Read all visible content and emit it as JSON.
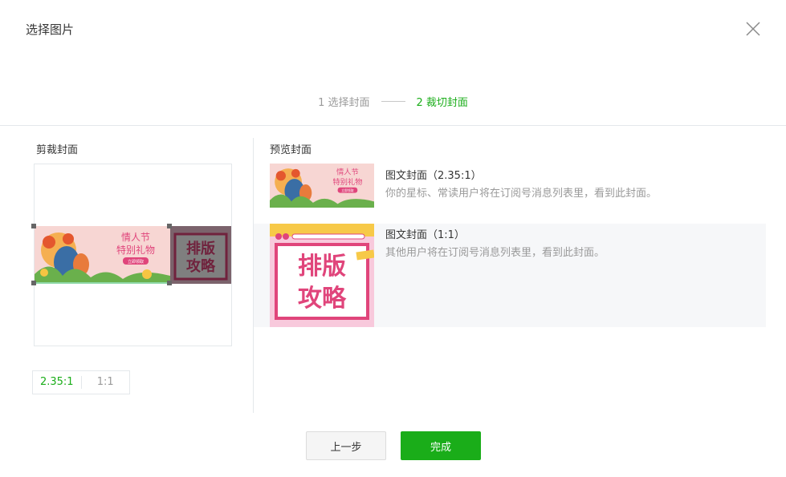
{
  "dialog": {
    "title": "选择图片"
  },
  "steps": [
    {
      "label": "1 选择封面",
      "active": false
    },
    {
      "label": "2 裁切封面",
      "active": true
    }
  ],
  "crop": {
    "label": "剪裁封面",
    "ratio_options": [
      {
        "label": "2.35:1",
        "active": true
      },
      {
        "label": "1:1",
        "active": false
      }
    ]
  },
  "preview": {
    "label": "预览封面",
    "items": [
      {
        "title": "图文封面（2.35:1）",
        "desc": "你的星标、常读用户将在订阅号消息列表里，看到此封面。"
      },
      {
        "title": "图文封面（1:1）",
        "desc": "其他用户将在订阅号消息列表里，看到此封面。"
      }
    ]
  },
  "cover_art": {
    "valentine_line1": "情人节",
    "valentine_line2": "特别礼物",
    "valentine_badge": "立即领取",
    "layout_line1": "排版",
    "layout_line2": "攻略"
  },
  "buttons": {
    "prev": "上一步",
    "done": "完成"
  },
  "colors": {
    "accent": "#1aad19",
    "muted": "#9a9a9a",
    "pink": "#e0457b"
  }
}
